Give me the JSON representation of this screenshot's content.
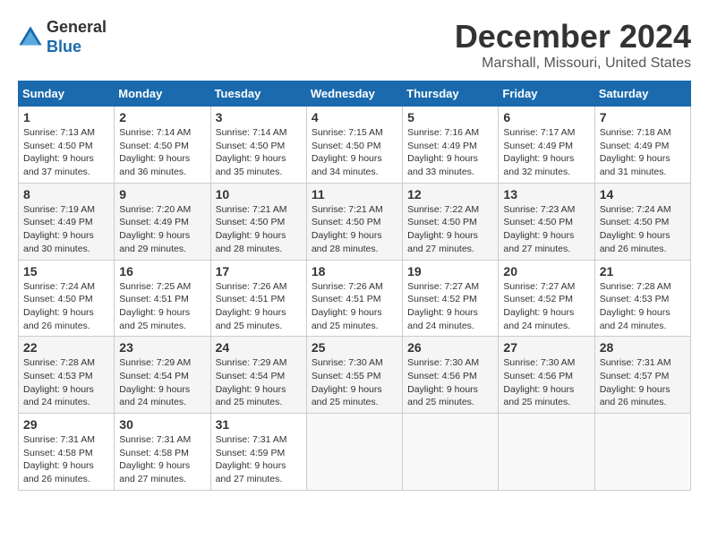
{
  "header": {
    "logo_line1": "General",
    "logo_line2": "Blue",
    "month_title": "December 2024",
    "location": "Marshall, Missouri, United States"
  },
  "calendar": {
    "days_of_week": [
      "Sunday",
      "Monday",
      "Tuesday",
      "Wednesday",
      "Thursday",
      "Friday",
      "Saturday"
    ],
    "weeks": [
      [
        {
          "day": "",
          "info": ""
        },
        {
          "day": "2",
          "info": "Sunrise: 7:14 AM\nSunset: 4:50 PM\nDaylight: 9 hours and 36 minutes."
        },
        {
          "day": "3",
          "info": "Sunrise: 7:14 AM\nSunset: 4:50 PM\nDaylight: 9 hours and 35 minutes."
        },
        {
          "day": "4",
          "info": "Sunrise: 7:15 AM\nSunset: 4:50 PM\nDaylight: 9 hours and 34 minutes."
        },
        {
          "day": "5",
          "info": "Sunrise: 7:16 AM\nSunset: 4:49 PM\nDaylight: 9 hours and 33 minutes."
        },
        {
          "day": "6",
          "info": "Sunrise: 7:17 AM\nSunset: 4:49 PM\nDaylight: 9 hours and 32 minutes."
        },
        {
          "day": "7",
          "info": "Sunrise: 7:18 AM\nSunset: 4:49 PM\nDaylight: 9 hours and 31 minutes."
        }
      ],
      [
        {
          "day": "1",
          "info": "Sunrise: 7:13 AM\nSunset: 4:50 PM\nDaylight: 9 hours and 37 minutes."
        },
        {
          "day": "",
          "info": ""
        },
        {
          "day": "",
          "info": ""
        },
        {
          "day": "",
          "info": ""
        },
        {
          "day": "",
          "info": ""
        },
        {
          "day": "",
          "info": ""
        },
        {
          "day": ""
        }
      ],
      [
        {
          "day": "8",
          "info": "Sunrise: 7:19 AM\nSunset: 4:49 PM\nDaylight: 9 hours and 30 minutes."
        },
        {
          "day": "9",
          "info": "Sunrise: 7:20 AM\nSunset: 4:49 PM\nDaylight: 9 hours and 29 minutes."
        },
        {
          "day": "10",
          "info": "Sunrise: 7:21 AM\nSunset: 4:50 PM\nDaylight: 9 hours and 28 minutes."
        },
        {
          "day": "11",
          "info": "Sunrise: 7:21 AM\nSunset: 4:50 PM\nDaylight: 9 hours and 28 minutes."
        },
        {
          "day": "12",
          "info": "Sunrise: 7:22 AM\nSunset: 4:50 PM\nDaylight: 9 hours and 27 minutes."
        },
        {
          "day": "13",
          "info": "Sunrise: 7:23 AM\nSunset: 4:50 PM\nDaylight: 9 hours and 27 minutes."
        },
        {
          "day": "14",
          "info": "Sunrise: 7:24 AM\nSunset: 4:50 PM\nDaylight: 9 hours and 26 minutes."
        }
      ],
      [
        {
          "day": "15",
          "info": "Sunrise: 7:24 AM\nSunset: 4:50 PM\nDaylight: 9 hours and 26 minutes."
        },
        {
          "day": "16",
          "info": "Sunrise: 7:25 AM\nSunset: 4:51 PM\nDaylight: 9 hours and 25 minutes."
        },
        {
          "day": "17",
          "info": "Sunrise: 7:26 AM\nSunset: 4:51 PM\nDaylight: 9 hours and 25 minutes."
        },
        {
          "day": "18",
          "info": "Sunrise: 7:26 AM\nSunset: 4:51 PM\nDaylight: 9 hours and 25 minutes."
        },
        {
          "day": "19",
          "info": "Sunrise: 7:27 AM\nSunset: 4:52 PM\nDaylight: 9 hours and 24 minutes."
        },
        {
          "day": "20",
          "info": "Sunrise: 7:27 AM\nSunset: 4:52 PM\nDaylight: 9 hours and 24 minutes."
        },
        {
          "day": "21",
          "info": "Sunrise: 7:28 AM\nSunset: 4:53 PM\nDaylight: 9 hours and 24 minutes."
        }
      ],
      [
        {
          "day": "22",
          "info": "Sunrise: 7:28 AM\nSunset: 4:53 PM\nDaylight: 9 hours and 24 minutes."
        },
        {
          "day": "23",
          "info": "Sunrise: 7:29 AM\nSunset: 4:54 PM\nDaylight: 9 hours and 24 minutes."
        },
        {
          "day": "24",
          "info": "Sunrise: 7:29 AM\nSunset: 4:54 PM\nDaylight: 9 hours and 25 minutes."
        },
        {
          "day": "25",
          "info": "Sunrise: 7:30 AM\nSunset: 4:55 PM\nDaylight: 9 hours and 25 minutes."
        },
        {
          "day": "26",
          "info": "Sunrise: 7:30 AM\nSunset: 4:56 PM\nDaylight: 9 hours and 25 minutes."
        },
        {
          "day": "27",
          "info": "Sunrise: 7:30 AM\nSunset: 4:56 PM\nDaylight: 9 hours and 25 minutes."
        },
        {
          "day": "28",
          "info": "Sunrise: 7:31 AM\nSunset: 4:57 PM\nDaylight: 9 hours and 26 minutes."
        }
      ],
      [
        {
          "day": "29",
          "info": "Sunrise: 7:31 AM\nSunset: 4:58 PM\nDaylight: 9 hours and 26 minutes."
        },
        {
          "day": "30",
          "info": "Sunrise: 7:31 AM\nSunset: 4:58 PM\nDaylight: 9 hours and 27 minutes."
        },
        {
          "day": "31",
          "info": "Sunrise: 7:31 AM\nSunset: 4:59 PM\nDaylight: 9 hours and 27 minutes."
        },
        {
          "day": "",
          "info": ""
        },
        {
          "day": "",
          "info": ""
        },
        {
          "day": "",
          "info": ""
        },
        {
          "day": "",
          "info": ""
        }
      ]
    ]
  }
}
